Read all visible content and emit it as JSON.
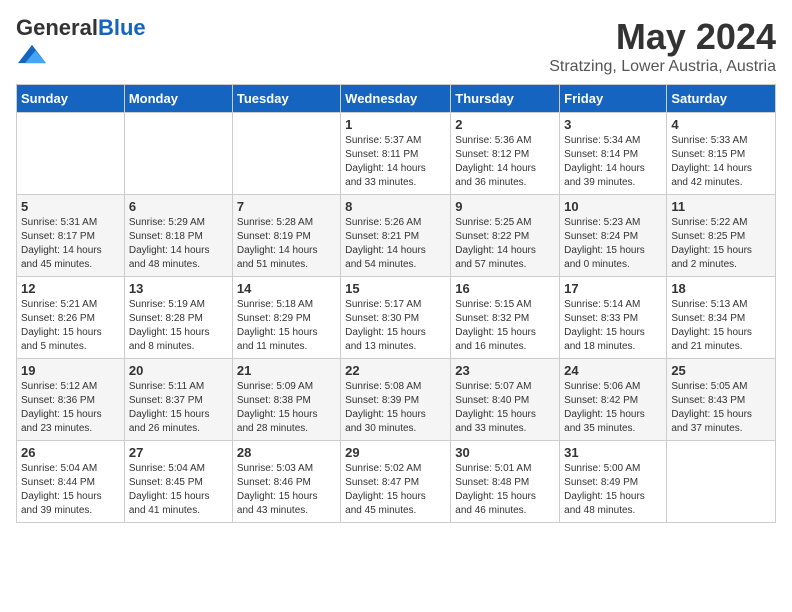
{
  "header": {
    "logo_general": "General",
    "logo_blue": "Blue",
    "month_title": "May 2024",
    "location": "Stratzing, Lower Austria, Austria"
  },
  "weekdays": [
    "Sunday",
    "Monday",
    "Tuesday",
    "Wednesday",
    "Thursday",
    "Friday",
    "Saturday"
  ],
  "weeks": [
    [
      {
        "day": "",
        "info": ""
      },
      {
        "day": "",
        "info": ""
      },
      {
        "day": "",
        "info": ""
      },
      {
        "day": "1",
        "info": "Sunrise: 5:37 AM\nSunset: 8:11 PM\nDaylight: 14 hours\nand 33 minutes."
      },
      {
        "day": "2",
        "info": "Sunrise: 5:36 AM\nSunset: 8:12 PM\nDaylight: 14 hours\nand 36 minutes."
      },
      {
        "day": "3",
        "info": "Sunrise: 5:34 AM\nSunset: 8:14 PM\nDaylight: 14 hours\nand 39 minutes."
      },
      {
        "day": "4",
        "info": "Sunrise: 5:33 AM\nSunset: 8:15 PM\nDaylight: 14 hours\nand 42 minutes."
      }
    ],
    [
      {
        "day": "5",
        "info": "Sunrise: 5:31 AM\nSunset: 8:17 PM\nDaylight: 14 hours\nand 45 minutes."
      },
      {
        "day": "6",
        "info": "Sunrise: 5:29 AM\nSunset: 8:18 PM\nDaylight: 14 hours\nand 48 minutes."
      },
      {
        "day": "7",
        "info": "Sunrise: 5:28 AM\nSunset: 8:19 PM\nDaylight: 14 hours\nand 51 minutes."
      },
      {
        "day": "8",
        "info": "Sunrise: 5:26 AM\nSunset: 8:21 PM\nDaylight: 14 hours\nand 54 minutes."
      },
      {
        "day": "9",
        "info": "Sunrise: 5:25 AM\nSunset: 8:22 PM\nDaylight: 14 hours\nand 57 minutes."
      },
      {
        "day": "10",
        "info": "Sunrise: 5:23 AM\nSunset: 8:24 PM\nDaylight: 15 hours\nand 0 minutes."
      },
      {
        "day": "11",
        "info": "Sunrise: 5:22 AM\nSunset: 8:25 PM\nDaylight: 15 hours\nand 2 minutes."
      }
    ],
    [
      {
        "day": "12",
        "info": "Sunrise: 5:21 AM\nSunset: 8:26 PM\nDaylight: 15 hours\nand 5 minutes."
      },
      {
        "day": "13",
        "info": "Sunrise: 5:19 AM\nSunset: 8:28 PM\nDaylight: 15 hours\nand 8 minutes."
      },
      {
        "day": "14",
        "info": "Sunrise: 5:18 AM\nSunset: 8:29 PM\nDaylight: 15 hours\nand 11 minutes."
      },
      {
        "day": "15",
        "info": "Sunrise: 5:17 AM\nSunset: 8:30 PM\nDaylight: 15 hours\nand 13 minutes."
      },
      {
        "day": "16",
        "info": "Sunrise: 5:15 AM\nSunset: 8:32 PM\nDaylight: 15 hours\nand 16 minutes."
      },
      {
        "day": "17",
        "info": "Sunrise: 5:14 AM\nSunset: 8:33 PM\nDaylight: 15 hours\nand 18 minutes."
      },
      {
        "day": "18",
        "info": "Sunrise: 5:13 AM\nSunset: 8:34 PM\nDaylight: 15 hours\nand 21 minutes."
      }
    ],
    [
      {
        "day": "19",
        "info": "Sunrise: 5:12 AM\nSunset: 8:36 PM\nDaylight: 15 hours\nand 23 minutes."
      },
      {
        "day": "20",
        "info": "Sunrise: 5:11 AM\nSunset: 8:37 PM\nDaylight: 15 hours\nand 26 minutes."
      },
      {
        "day": "21",
        "info": "Sunrise: 5:09 AM\nSunset: 8:38 PM\nDaylight: 15 hours\nand 28 minutes."
      },
      {
        "day": "22",
        "info": "Sunrise: 5:08 AM\nSunset: 8:39 PM\nDaylight: 15 hours\nand 30 minutes."
      },
      {
        "day": "23",
        "info": "Sunrise: 5:07 AM\nSunset: 8:40 PM\nDaylight: 15 hours\nand 33 minutes."
      },
      {
        "day": "24",
        "info": "Sunrise: 5:06 AM\nSunset: 8:42 PM\nDaylight: 15 hours\nand 35 minutes."
      },
      {
        "day": "25",
        "info": "Sunrise: 5:05 AM\nSunset: 8:43 PM\nDaylight: 15 hours\nand 37 minutes."
      }
    ],
    [
      {
        "day": "26",
        "info": "Sunrise: 5:04 AM\nSunset: 8:44 PM\nDaylight: 15 hours\nand 39 minutes."
      },
      {
        "day": "27",
        "info": "Sunrise: 5:04 AM\nSunset: 8:45 PM\nDaylight: 15 hours\nand 41 minutes."
      },
      {
        "day": "28",
        "info": "Sunrise: 5:03 AM\nSunset: 8:46 PM\nDaylight: 15 hours\nand 43 minutes."
      },
      {
        "day": "29",
        "info": "Sunrise: 5:02 AM\nSunset: 8:47 PM\nDaylight: 15 hours\nand 45 minutes."
      },
      {
        "day": "30",
        "info": "Sunrise: 5:01 AM\nSunset: 8:48 PM\nDaylight: 15 hours\nand 46 minutes."
      },
      {
        "day": "31",
        "info": "Sunrise: 5:00 AM\nSunset: 8:49 PM\nDaylight: 15 hours\nand 48 minutes."
      },
      {
        "day": "",
        "info": ""
      }
    ]
  ]
}
